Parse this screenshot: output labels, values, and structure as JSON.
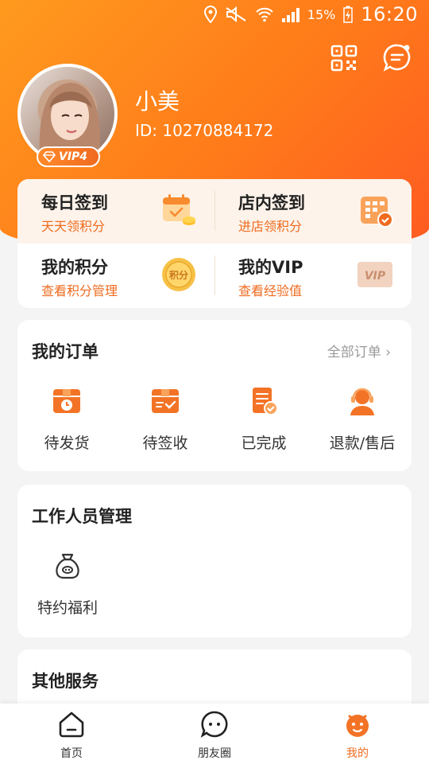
{
  "status_bar": {
    "battery": "15%",
    "time": "16:20"
  },
  "profile": {
    "name": "小美",
    "id": "ID: 10270884172",
    "vip_level": "VIP4"
  },
  "quick": [
    {
      "title": "每日签到",
      "subtitle": "天天领积分",
      "icon": "calendar-coin-icon"
    },
    {
      "title": "店内签到",
      "subtitle": "进店领积分",
      "icon": "store-checkin-icon"
    },
    {
      "title": "我的积分",
      "subtitle": "查看积分管理",
      "icon": "points-coin-icon",
      "icon_text": "积分"
    },
    {
      "title": "我的VIP",
      "subtitle": "查看经验值",
      "icon": "vip-card-icon",
      "icon_text": "VIP"
    }
  ],
  "orders": {
    "title": "我的订单",
    "all_label": "全部订单",
    "items": [
      {
        "label": "待发货",
        "icon": "box-clock-icon"
      },
      {
        "label": "待签收",
        "icon": "box-check-icon"
      },
      {
        "label": "已完成",
        "icon": "document-check-icon"
      },
      {
        "label": "退款/售后",
        "icon": "customer-service-icon"
      }
    ]
  },
  "staff": {
    "title": "工作人员管理",
    "items": [
      {
        "label": "特约福利",
        "icon": "money-bag-icon"
      }
    ]
  },
  "other": {
    "title": "其他服务"
  },
  "tabbar": [
    {
      "label": "首页",
      "icon": "home-icon",
      "active": false
    },
    {
      "label": "朋友圈",
      "icon": "chat-bubble-icon",
      "active": false
    },
    {
      "label": "我的",
      "icon": "profile-face-icon",
      "active": true
    }
  ],
  "colors": {
    "accent": "#ef6b1f",
    "hero_start": "#ff9a1e",
    "hero_end": "#ff5a22"
  }
}
